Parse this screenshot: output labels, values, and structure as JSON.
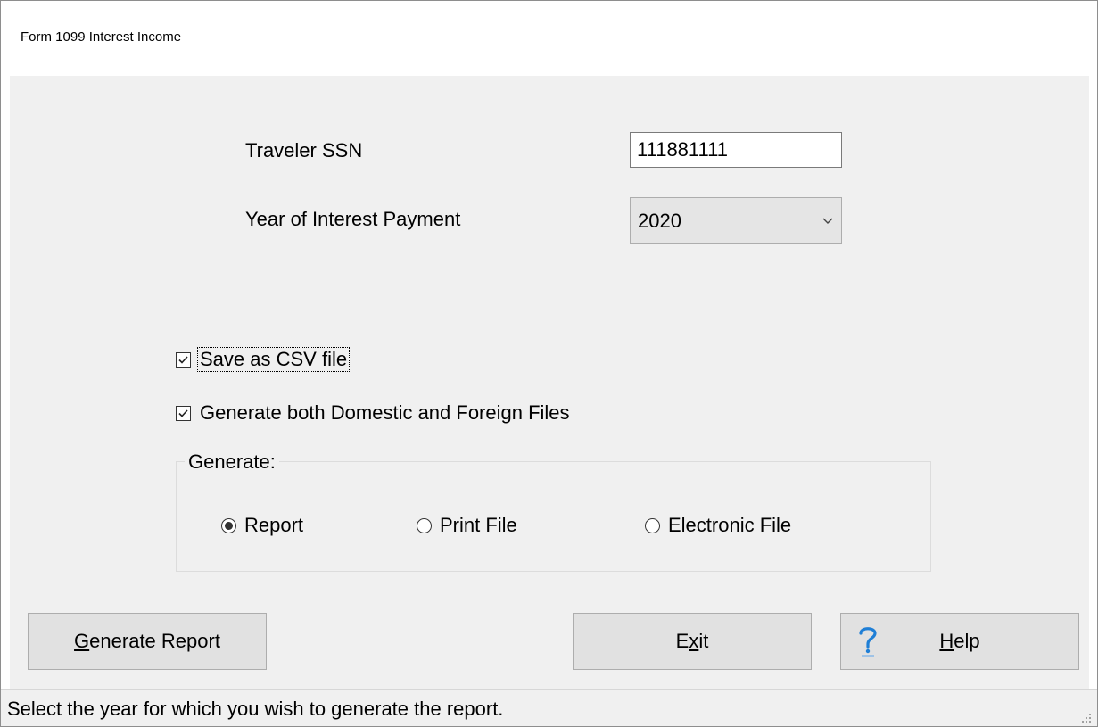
{
  "window": {
    "title": "Form 1099 Interest Income"
  },
  "form": {
    "ssn_label": "Traveler SSN",
    "ssn_value": "111881111",
    "year_label": "Year of Interest Payment",
    "year_value": "2020",
    "save_csv_label": "Save as CSV file",
    "save_csv_checked": true,
    "generate_both_label": "Generate both Domestic and Foreign Files",
    "generate_both_checked": true
  },
  "generate_group": {
    "title": "Generate:",
    "options": [
      {
        "label": "Report",
        "selected": true
      },
      {
        "label": "Print File",
        "selected": false
      },
      {
        "label": "Electronic File",
        "selected": false
      }
    ]
  },
  "buttons": {
    "generate_report": {
      "mnemonic": "G",
      "rest": "enerate Report"
    },
    "exit": {
      "pre": "E",
      "mnemonic": "x",
      "post": "it"
    },
    "help": {
      "mnemonic": "H",
      "rest": "elp",
      "icon": "question-mark-icon",
      "icon_color": "#1f7fd6"
    }
  },
  "status_bar": {
    "text": "Select the year for which you wish to generate the report."
  },
  "colors": {
    "window_bg": "#f0f0f0",
    "button_bg": "#e1e1e1",
    "combo_bg": "#e5e5e5"
  }
}
